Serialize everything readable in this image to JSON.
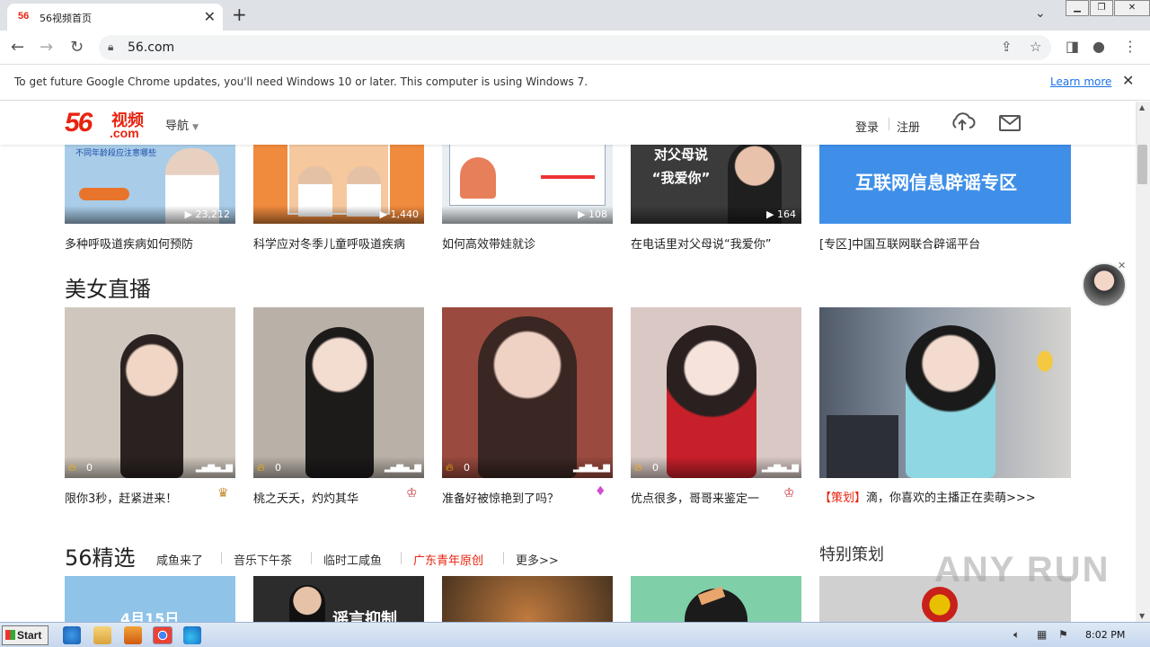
{
  "browser": {
    "tab_title": "56视频首页",
    "tab_favicon": "56",
    "url": "56.com",
    "infobar_message": "To get future Google Chrome updates, you'll need Windows 10 or later. This computer is using Windows 7.",
    "infobar_link": "Learn more"
  },
  "header": {
    "logo_number": "56",
    "logo_text": "视频",
    "logo_domain": ".com",
    "nav_label": "导航",
    "login": "登录",
    "register": "注册"
  },
  "top_row": [
    {
      "caption": "多种呼吸道疾病如何预防",
      "count": "23,212",
      "thumb_text": "不同年龄段应注意哪些",
      "color": "#a9cde9"
    },
    {
      "caption": "科学应对冬季儿童呼吸道疾病",
      "count": "1,440",
      "thumb_text": "",
      "color": "#f08a3c"
    },
    {
      "caption": "如何高效带娃就诊",
      "count": "108",
      "thumb_text": "",
      "color": "#e9eef2"
    },
    {
      "caption": "在电话里对父母说“我爱你”",
      "count": "164",
      "thumb_text": "对父母说 “我爱你”",
      "color": "#3b3b3b"
    },
    {
      "caption": "[专区]中国互联网联合辟谣平台",
      "count": "",
      "thumb_text": "互联网信息辟谣专区",
      "color": "#3f8fe9"
    }
  ],
  "live": {
    "heading": "美女直播",
    "items": [
      {
        "caption": "限你3秒，赶紧进来！",
        "count": "0",
        "color": "#cfc7bd",
        "badge": "♛"
      },
      {
        "caption": "桃之夭夭，灼灼其华",
        "count": "0",
        "color": "#b9b1a8",
        "badge": "♔"
      },
      {
        "caption": "准备好被惊艳到了吗？",
        "count": "0",
        "color": "#9a4a3e",
        "badge": "♦"
      },
      {
        "caption": "优点很多，哥哥来鉴定一",
        "count": "0",
        "color": "#d9c8c4",
        "badge": "♔"
      }
    ],
    "promo_tag": "【策划】",
    "promo_text": "滴，你喜欢的主播正在卖萌>>>"
  },
  "selection": {
    "heading": "56精选",
    "tabs": [
      "咸鱼来了",
      "音乐下午茶",
      "临时工咸鱼",
      "广东青年原创",
      "更多>>"
    ],
    "special_heading": "特别策划",
    "thumbs": [
      {
        "text": "4月15日",
        "color": "#8fc3e8"
      },
      {
        "text": "谣言抑制",
        "color": "#2c2c2c"
      },
      {
        "text": "",
        "color": "#8a6b4c"
      },
      {
        "text": "",
        "color": "#7fcfa8"
      },
      {
        "text": "",
        "color": "#d0d0d0"
      }
    ]
  },
  "watermark": "ANY RUN",
  "taskbar": {
    "start": "Start",
    "clock": "8:02 PM"
  },
  "colors": {
    "brand": "#e8230f",
    "promo": "#e8230f"
  }
}
